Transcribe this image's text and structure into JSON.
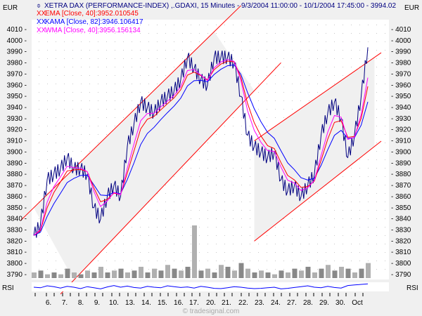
{
  "chart_data": {
    "type": "line",
    "title": "XETRA DAX (PERFORMANCE-INDEX) ,.GDAXI, 15 Minutes - 9/3/2004 11:00:00 - 10/1/2004 17:45:00 - 3994.02",
    "currency_label": "EUR",
    "legend": [
      {
        "name": "EMA [Close, 40]:3952.010545",
        "color": "#ff0000",
        "marker": "XX"
      },
      {
        "name": "KAMA [Close, 82]:3946.106417",
        "color": "#0000ff",
        "marker": "XX"
      },
      {
        "name": "WMA [Close, 40]:3956.156134",
        "color": "#ff00ff",
        "marker": "XX"
      }
    ],
    "ylim": [
      3785,
      4018
    ],
    "yticks": [
      3790,
      3800,
      3810,
      3820,
      3830,
      3840,
      3850,
      3860,
      3870,
      3880,
      3890,
      3900,
      3910,
      3920,
      3930,
      3940,
      3950,
      3960,
      3970,
      3980,
      3990,
      4000,
      4010
    ],
    "xticks": [
      "6.",
      "7.",
      "8.",
      "9.",
      "10.",
      "13.",
      "14.",
      "15.",
      "16.",
      "17.",
      "20.",
      "21.",
      "22.",
      "23.",
      "24.",
      "27.",
      "28.",
      "29.",
      "30.",
      "Oct"
    ],
    "price": [
      3825,
      3835,
      3875,
      3880,
      3885,
      3895,
      3885,
      3885,
      3880,
      3850,
      3840,
      3860,
      3870,
      3860,
      3905,
      3925,
      3945,
      3940,
      3935,
      3945,
      3950,
      3955,
      3965,
      3985,
      3975,
      3965,
      3960,
      3985,
      3985,
      3985,
      3980,
      3950,
      3915,
      3905,
      3900,
      3895,
      3900,
      3875,
      3865,
      3870,
      3860,
      3870,
      3880,
      3915,
      3935,
      3945,
      3930,
      3895,
      3915,
      3950,
      3994
    ],
    "volume": [
      3,
      4,
      2,
      3,
      2,
      5,
      3,
      2,
      4,
      3,
      6,
      3,
      4,
      5,
      3,
      4,
      6,
      3,
      5,
      4,
      7,
      5,
      4,
      6,
      28,
      4,
      5,
      3,
      7,
      6,
      4,
      8,
      5,
      3,
      4,
      3,
      2,
      4,
      3,
      5,
      4,
      6,
      3,
      5,
      7,
      4,
      6,
      5,
      3,
      5,
      8
    ],
    "rsi": [
      50,
      48,
      55,
      52,
      47,
      53,
      50,
      45,
      52,
      48,
      44,
      51,
      56,
      50,
      54,
      49,
      47,
      53,
      50,
      48,
      55,
      52,
      49,
      51,
      47,
      53,
      50,
      46,
      45,
      48,
      52,
      50,
      47,
      45,
      46,
      48,
      50,
      44,
      46,
      49,
      52,
      55,
      50,
      48,
      53,
      49,
      47,
      56,
      58,
      60,
      62
    ],
    "channels": [
      {
        "upper": [
          [
            0,
            3850
          ],
          [
            27,
            4008
          ]
        ],
        "lower": [
          [
            6,
            3785
          ],
          [
            33,
            3955
          ]
        ]
      },
      {
        "upper": [
          [
            33,
            3910
          ],
          [
            51,
            3985
          ]
        ],
        "lower": [
          [
            33,
            3820
          ],
          [
            51,
            3905
          ]
        ]
      }
    ],
    "rsi_label": "RSI",
    "copyright": "© tradesignal.com"
  }
}
